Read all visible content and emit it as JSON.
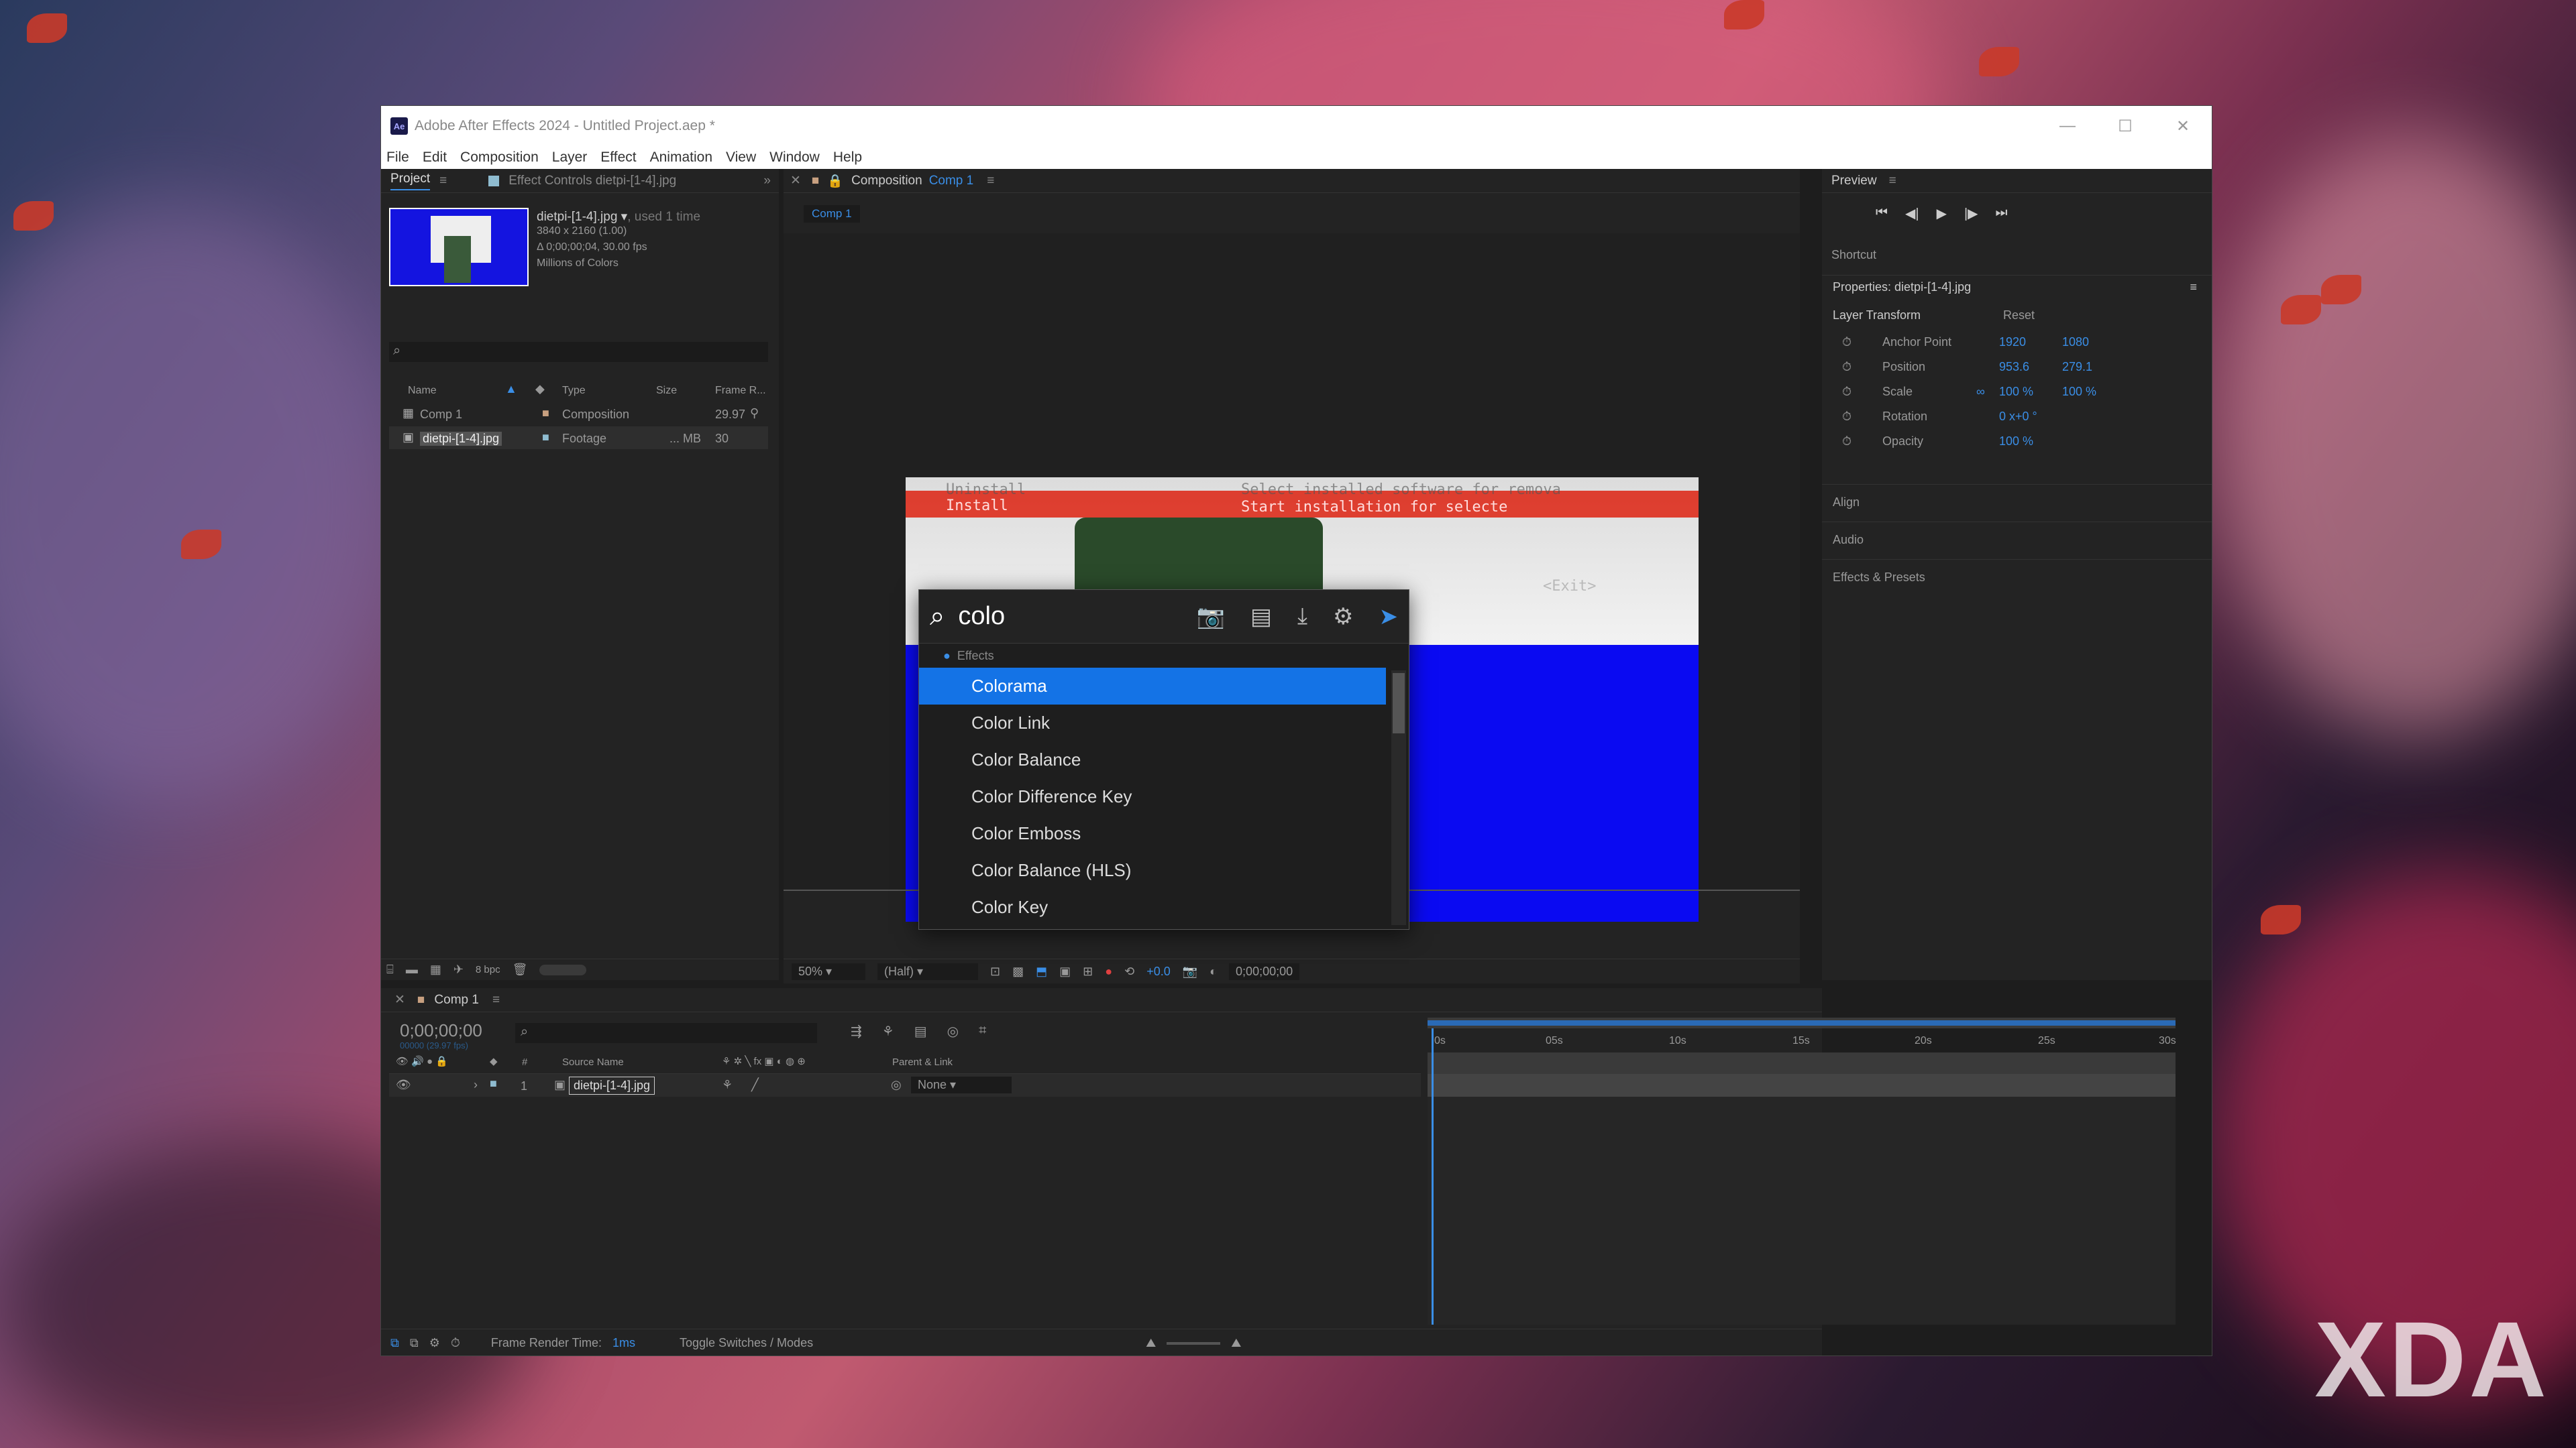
{
  "window": {
    "title": "Adobe After Effects 2024 - Untitled Project.aep *",
    "app_icon_text": "Ae",
    "controls": {
      "minimize": "—",
      "maximize": "☐",
      "close": "✕"
    }
  },
  "menu": [
    "File",
    "Edit",
    "Composition",
    "Layer",
    "Effect",
    "Animation",
    "View",
    "Window",
    "Help"
  ],
  "project_panel": {
    "tab_project": "Project",
    "tab_effect_controls": "Effect Controls dietpi-[1-4].jpg",
    "asset_name": "dietpi-[1-4].jpg",
    "asset_used": ", used 1 time",
    "asset_dims": "3840 x 2160 (1.00)",
    "asset_duration": "Δ 0;00;00;04, 30.00 fps",
    "asset_colors": "Millions of Colors",
    "columns": [
      "Name",
      "Type",
      "Size",
      "Frame R..."
    ],
    "rows": [
      {
        "name": "Comp 1",
        "type": "Composition",
        "size": "",
        "fps": "29.97"
      },
      {
        "name": "dietpi-[1-4].jpg",
        "type": "Footage",
        "size": "... MB",
        "fps": "30"
      }
    ],
    "bpc": "8 bpc"
  },
  "comp_panel": {
    "tab_label": "Composition",
    "comp_name": "Comp 1",
    "subtab": "Comp 1",
    "preview_text_line1": "Select installed software for remova",
    "preview_text_line2": "Start installation for selecte",
    "preview_text_line3": "<Exit>",
    "preview_text_left1": "Uninstall",
    "preview_text_left2": "Install",
    "zoom": "50%",
    "resolution": "(Half)",
    "exposure": "+0.0",
    "timecode": "0;00;00;00"
  },
  "search_popup": {
    "query": "colo",
    "category": "Effects",
    "items": [
      "Colorama",
      "Color Link",
      "Color Balance",
      "Color Difference Key",
      "Color Emboss",
      "Color Balance (HLS)",
      "Color Key"
    ],
    "selected_index": 0
  },
  "right_panel": {
    "preview_label": "Preview",
    "shortcut_label": "Shortcut",
    "properties_label": "Properties: dietpi-[1-4].jpg",
    "layer_transform": "Layer Transform",
    "reset": "Reset",
    "props": [
      {
        "name": "Anchor Point",
        "v1": "1920",
        "v2": "1080"
      },
      {
        "name": "Position",
        "v1": "953.6",
        "v2": "279.1"
      },
      {
        "name": "Scale",
        "v1": "100 %",
        "v2": "100 %"
      },
      {
        "name": "Rotation",
        "v1": "0 x+0 °",
        "v2": ""
      },
      {
        "name": "Opacity",
        "v1": "100 %",
        "v2": ""
      }
    ],
    "sections": [
      "Align",
      "Audio",
      "Effects & Presets"
    ]
  },
  "timeline": {
    "tab": "Comp 1",
    "timecode": "0;00;00;00",
    "timecode_sub": "00000 (29.97 fps)",
    "col_source": "Source Name",
    "col_parent": "Parent & Link",
    "col_num": "#",
    "layer_num": "1",
    "layer_name": "dietpi-[1-4].jpg",
    "parent_value": "None",
    "ruler": [
      "0s",
      "05s",
      "10s",
      "15s",
      "20s",
      "25s",
      "30s"
    ],
    "frame_render_label": "Frame Render Time:",
    "frame_render_value": "1ms",
    "toggle_label": "Toggle Switches / Modes"
  },
  "watermark": "XDA",
  "colors": {
    "accent": "#3a8ee6",
    "selection": "#1473e6",
    "panel": "#232323"
  }
}
